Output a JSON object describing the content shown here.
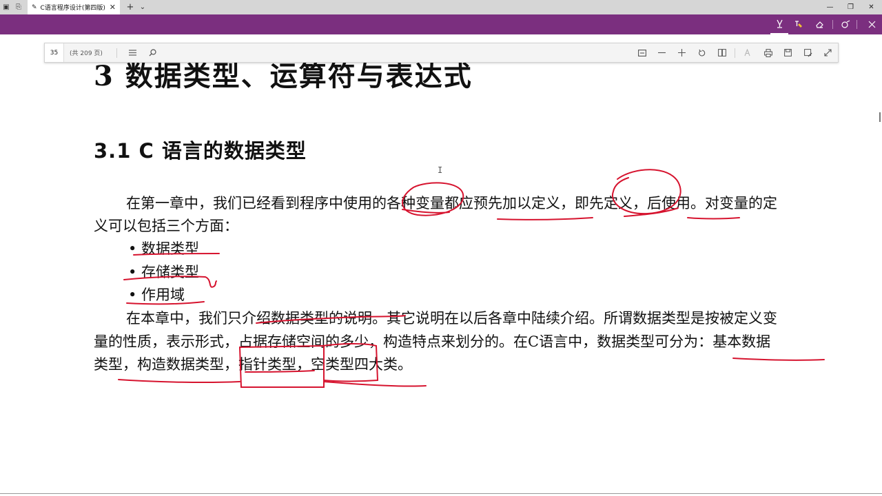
{
  "window": {
    "tab_title": "C语言程序设计(第四版)",
    "tab_close": "✕",
    "new_tab": "+",
    "tab_menu": "⌄",
    "minimize": "—",
    "restore": "❐",
    "close": "✕"
  },
  "app_toolbar": {
    "icons": [
      "highlighter-icon",
      "highlight-text-icon",
      "eraser-icon",
      "touch-write-icon",
      "close-icon"
    ]
  },
  "pdf_toolbar": {
    "page_number": "35",
    "page_total": "(共 209 页)",
    "icons": [
      "toc-icon",
      "search-icon",
      "fit-page-icon",
      "zoom-out-icon",
      "zoom-in-icon",
      "rotate-icon",
      "page-view-icon",
      "read-aloud-icon",
      "print-icon",
      "save-icon",
      "save-as-icon",
      "fullscreen-icon"
    ]
  },
  "document": {
    "chapter_title": "3  数据类型、运算符与表达式",
    "section_title": "3.1  C 语言的数据类型",
    "paragraph1_line1": "在第一章中，我们已经看到程序中使用的各种变量都应预先加以定义，即先定义，后使用。对变量的定",
    "paragraph1_line2": "义可以包括三个方面：",
    "bullets": [
      "• 数据类型",
      "• 存储类型",
      "• 作用域"
    ],
    "paragraph2_line1": "在本章中，我们只介绍数据类型的说明。其它说明在以后各章中陆续介绍。所谓数据类型是按被定义变",
    "paragraph2_line2": "量的性质，表示形式，占据存储空间的多少，构造特点来划分的。在C语言中，数据类型可分为：基本数据",
    "paragraph2_line3": "类型，构造数据类型，指针类型，空类型四大类。"
  },
  "colors": {
    "titlebar": "#d6d6d6",
    "appbar": "#7b2f7f",
    "annotation_ink": "#d6132e",
    "text": "#111111"
  }
}
